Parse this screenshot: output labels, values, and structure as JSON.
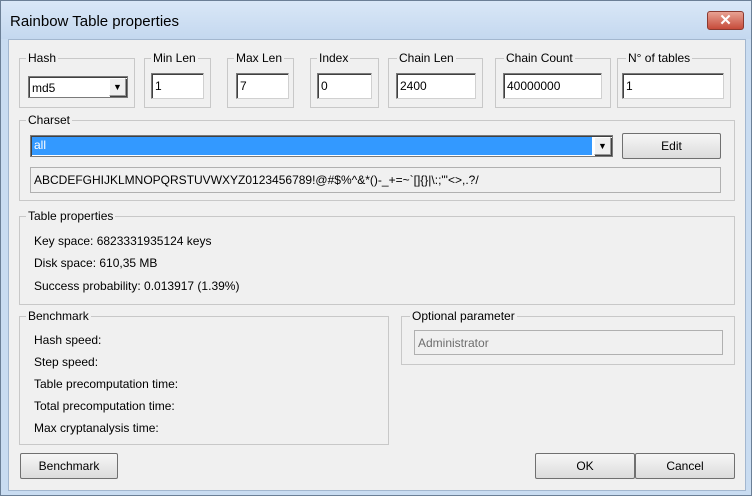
{
  "window": {
    "title": "Rainbow Table properties",
    "close_glyph": "✕"
  },
  "hash": {
    "label": "Hash",
    "value": "md5"
  },
  "min_len": {
    "label": "Min Len",
    "value": "1"
  },
  "max_len": {
    "label": "Max Len",
    "value": "7"
  },
  "index": {
    "label": "Index",
    "value": "0"
  },
  "chain_len": {
    "label": "Chain Len",
    "value": "2400"
  },
  "chain_count": {
    "label": "Chain Count",
    "value": "40000000"
  },
  "num_tables": {
    "label": "N° of tables",
    "value": "1"
  },
  "charset": {
    "label": "Charset",
    "selected": "all",
    "edit_label": "Edit",
    "characters": "ABCDEFGHIJKLMNOPQRSTUVWXYZ0123456789!@#$%^&*()-_+=~`[]{}|\\:;\"'<>,.?/"
  },
  "table_properties": {
    "label": "Table properties",
    "key_space": "Key space: 6823331935124 keys",
    "disk_space": "Disk space: 610,35 MB",
    "success_probability": "Success probability: 0.013917 (1.39%)"
  },
  "benchmark": {
    "label": "Benchmark",
    "rows": [
      "Hash speed:",
      "Step speed:",
      "Table precomputation time:",
      "Total precomputation time:",
      "Max cryptanalysis time:"
    ],
    "button": "Benchmark"
  },
  "optional": {
    "label": "Optional parameter",
    "value": "Administrator"
  },
  "buttons": {
    "ok": "OK",
    "cancel": "Cancel"
  },
  "colors": {
    "selection": "#3399ff",
    "close": "#c64b3a",
    "title_bar": "#c9dcf1"
  }
}
